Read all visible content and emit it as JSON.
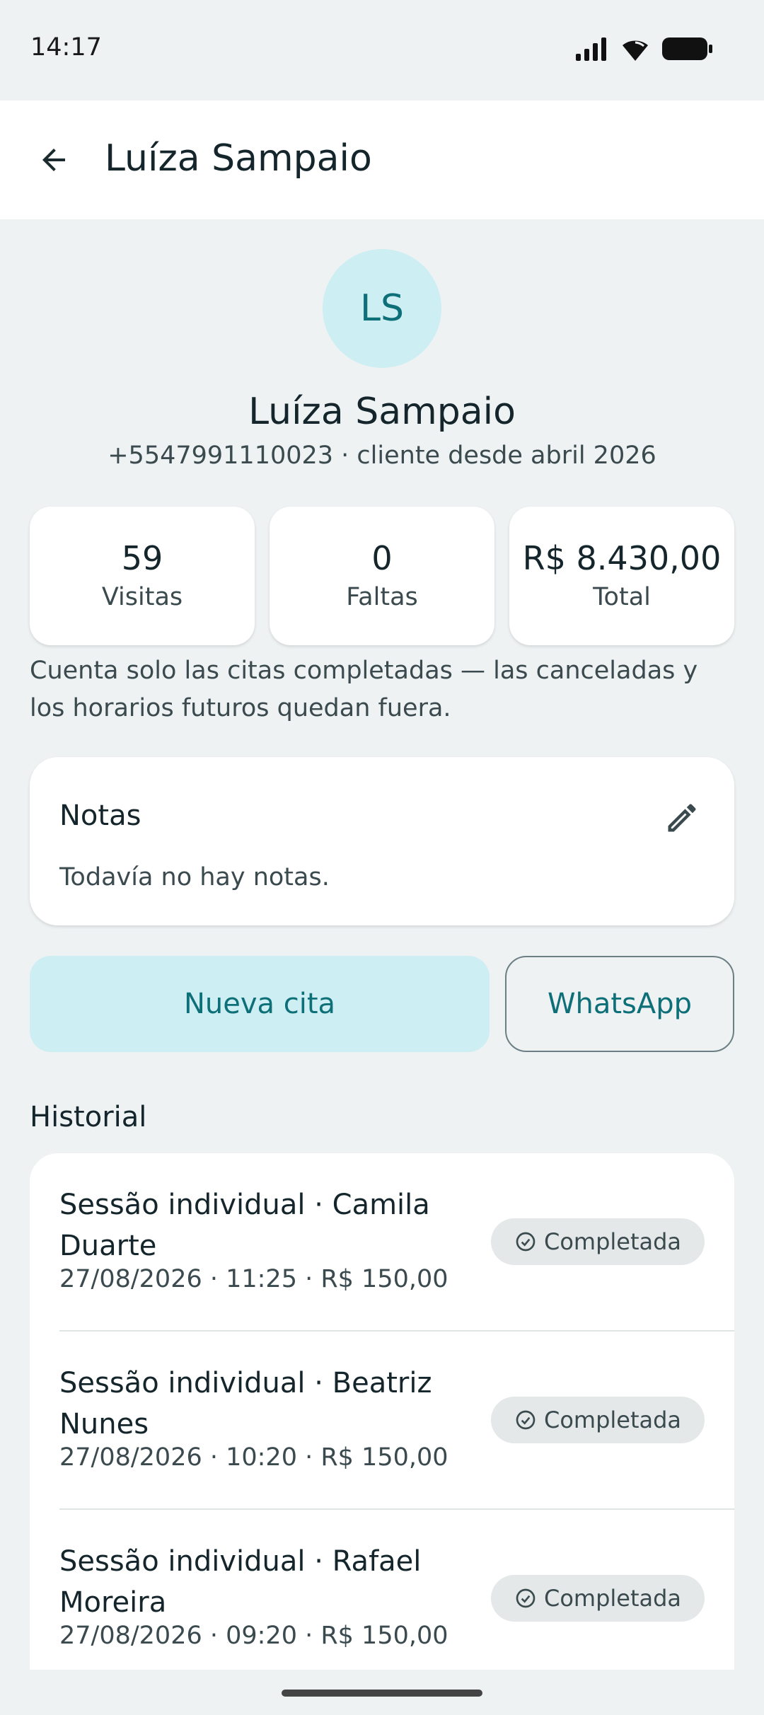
{
  "status_bar": {
    "time": "14:17"
  },
  "app_bar": {
    "title": "Luíza Sampaio"
  },
  "client": {
    "initials": "LS",
    "name": "Luíza Sampaio",
    "subtitle": "+5547991110023 · cliente desde abril 2026"
  },
  "stats": [
    {
      "value": "59",
      "label": "Visitas"
    },
    {
      "value": "0",
      "label": "Faltas"
    },
    {
      "value": "R$ 8.430,00",
      "label": "Total"
    }
  ],
  "stats_note": "Cuenta solo las citas completadas — las canceladas y los horarios futuros quedan fuera.",
  "notes": {
    "title": "Notas",
    "empty_text": "Todavía no hay notas."
  },
  "actions": {
    "new_appointment": "Nueva cita",
    "whatsapp": "WhatsApp"
  },
  "history": {
    "title": "Historial",
    "items": [
      {
        "title": "Sessão individual · Camila Duarte",
        "meta": "27/08/2026 · 11:25 · R$ 150,00",
        "status": "Completada"
      },
      {
        "title": "Sessão individual · Beatriz Nunes",
        "meta": "27/08/2026 · 10:20 · R$ 150,00",
        "status": "Completada"
      },
      {
        "title": "Sessão individual · Rafael Moreira",
        "meta": "27/08/2026 · 09:20 · R$ 150,00",
        "status": "Completada"
      }
    ]
  },
  "colors": {
    "accent": "#0d6f78",
    "accent_light": "#cdeef2",
    "background": "#eef2f3"
  },
  "icons": [
    "signal-icon",
    "wifi-icon",
    "battery-icon",
    "back-arrow-icon",
    "pencil-icon",
    "check-circle-icon"
  ]
}
